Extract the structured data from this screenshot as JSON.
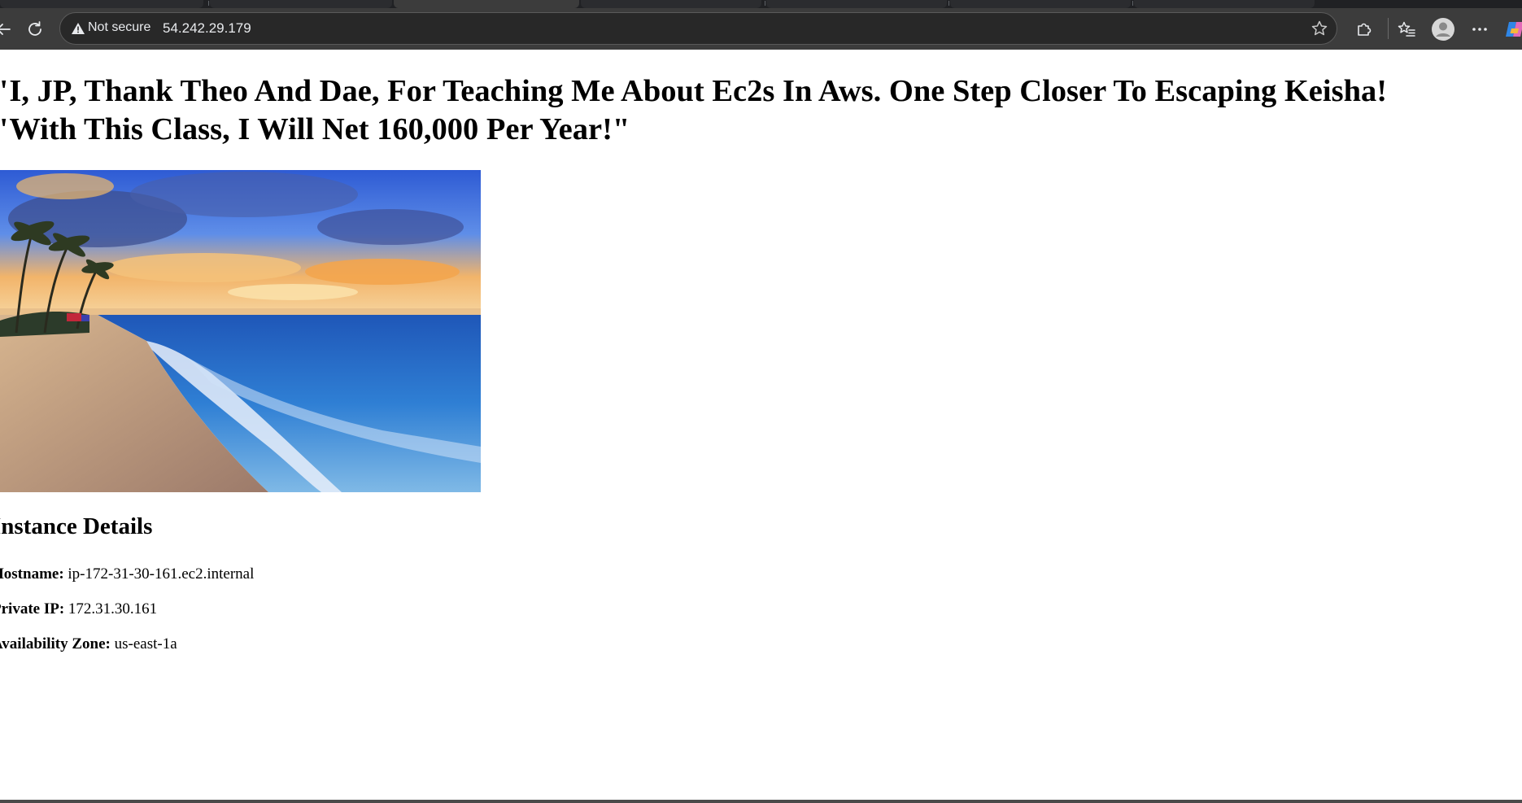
{
  "browser": {
    "security_label": "Not secure",
    "url": "54.242.29.179"
  },
  "page": {
    "headline_line1": "\"I, JP, Thank Theo And Dae, For Teaching Me About Ec2s In Aws. One Step Closer To Escaping Keisha!",
    "headline_line2": "\"With This Class, I Will Net 160,000 Per Year!\"",
    "details_title": "Instance Details",
    "details": [
      {
        "label": "Hostname:",
        "value": "ip-172-31-30-161.ec2.internal"
      },
      {
        "label": "Private IP:",
        "value": "172.31.30.161"
      },
      {
        "label": "Availability Zone:",
        "value": "us-east-1a"
      }
    ]
  }
}
